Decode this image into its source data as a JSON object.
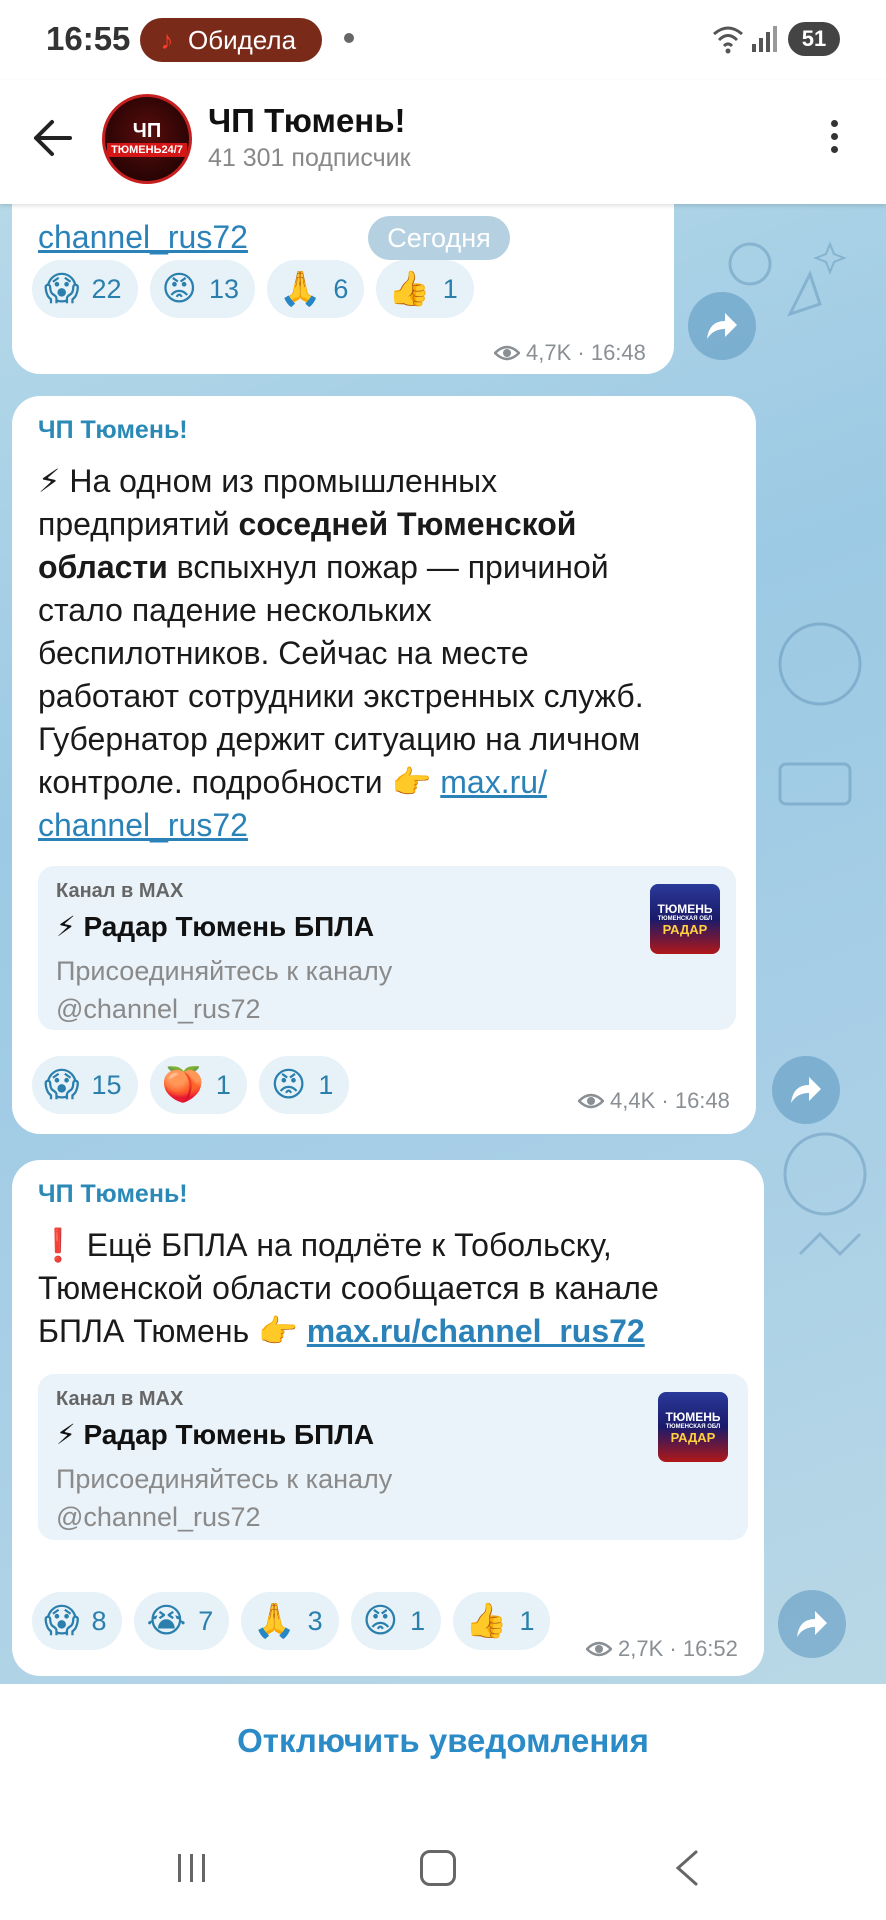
{
  "status_bar": {
    "time": "16:55",
    "media_title": "Обидела",
    "battery": "51"
  },
  "header": {
    "avatar_text_top": "ЧП",
    "avatar_text_bottom": "ТЮМЕНЬ24/7",
    "title": "ЧП Тюмень!",
    "subtitle": "41 301 подписчик"
  },
  "date_pill": "Сегодня",
  "messages": [
    {
      "text_tail": "channel_rus72",
      "reactions": [
        {
          "emoji": "😱",
          "count": "22"
        },
        {
          "emoji": "😡",
          "count": "13"
        },
        {
          "emoji": "🙏",
          "count": "6"
        },
        {
          "emoji": "👍",
          "count": "1"
        }
      ],
      "views": "4,7K",
      "time": "16:48"
    },
    {
      "sender": "ЧП Тюмень!",
      "emoji_lead": "⚡",
      "text_1": "На одном из промышленных",
      "text_2a": "предприятий ",
      "text_2b": "соседней Тюменской",
      "text_3a": "области",
      "text_3b": " вспыхнул пожар — причиной",
      "text_4": "стало падение нескольких",
      "text_5": "беспилотников. Сейчас на месте",
      "text_6": "работают сотрудники экстренных служб.",
      "text_7": "Губернатор держит ситуацию на личном",
      "text_8": "контроле. подробности 👉 ",
      "link_a": "max.ru/",
      "link_b": "channel_rus72",
      "preview": {
        "site": "Канал в MAX",
        "title": "⚡ Радар Тюмень БПЛА",
        "desc_1": "Присоединяйтесь к каналу",
        "desc_2": "@channel_rus72",
        "thumb_1": "ТЮМЕНЬ",
        "thumb_2": "ТЮМЕНСКАЯ ОБЛ",
        "thumb_3": "РАДАР"
      },
      "reactions": [
        {
          "emoji": "😱",
          "count": "15"
        },
        {
          "emoji": "🍑",
          "count": "1"
        },
        {
          "emoji": "😡",
          "count": "1"
        }
      ],
      "views": "4,4K",
      "time": "16:48"
    },
    {
      "sender": "ЧП Тюмень!",
      "emoji_lead": "❗",
      "text_1": "Ещё БПЛА на подлёте к Тобольску,",
      "text_2": "Тюменской области сообщается в канале",
      "text_3": "БПЛА Тюмень 👉 ",
      "link": "max.ru/channel_rus72",
      "preview": {
        "site": "Канал в MAX",
        "title": "⚡ Радар Тюмень БПЛА",
        "desc_1": "Присоединяйтесь к каналу",
        "desc_2": "@channel_rus72",
        "thumb_1": "ТЮМЕНЬ",
        "thumb_2": "ТЮМЕНСКАЯ ОБЛ",
        "thumb_3": "РАДАР"
      },
      "reactions": [
        {
          "emoji": "😱",
          "count": "8"
        },
        {
          "emoji": "😭",
          "count": "7"
        },
        {
          "emoji": "🙏",
          "count": "3"
        },
        {
          "emoji": "😡",
          "count": "1"
        },
        {
          "emoji": "👍",
          "count": "1"
        }
      ],
      "views": "2,7K",
      "time": "16:52"
    }
  ],
  "bottom": {
    "mute_label": "Отключить уведомления"
  },
  "colors": {
    "accent": "#2a8bc7",
    "sender": "#2a89b6",
    "reaction_bg": "#e6f1f8"
  }
}
